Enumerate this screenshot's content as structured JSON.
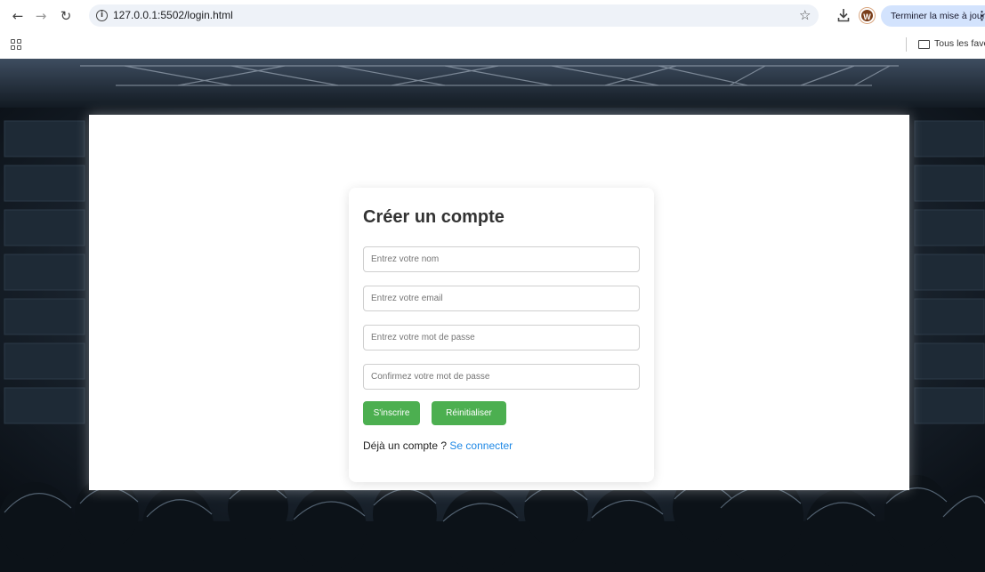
{
  "browser": {
    "url": "127.0.0.1:5502/login.html",
    "update_label": "Terminer la mise à jour",
    "profile_initial": "W",
    "bookmarks_label": "Tous les favoris"
  },
  "page": {
    "title": "Créer un compte",
    "fields": {
      "name_placeholder": "Entrez votre nom",
      "email_placeholder": "Entrez votre email",
      "password_placeholder": "Entrez votre mot de passe",
      "confirm_placeholder": "Confirmez votre mot de passe"
    },
    "buttons": {
      "signup": "S'inscrire",
      "reset": "Réinitialiser"
    },
    "footer": {
      "prompt": "Déjà un compte ?",
      "link": "Se connecter"
    }
  },
  "colors": {
    "button_green": "#4caf50",
    "link_blue": "#1e88e5",
    "update_pill": "#d3e3fd"
  }
}
